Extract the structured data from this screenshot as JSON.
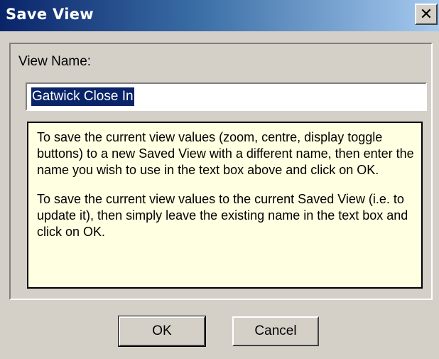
{
  "window": {
    "title": "Save View",
    "close_glyph": "✕",
    "close_icon": "close-icon"
  },
  "form": {
    "label": "View Name:",
    "input_value": "Gatwick Close In"
  },
  "info": {
    "paragraph1": "To save the current view values (zoom, centre, display toggle buttons) to a new Saved View with a different name, then enter the name you wish to use in the text box above and click on OK.",
    "paragraph2": "To save the current view values to the current Saved View (i.e. to update it), then simply leave the existing name in the text box and click on OK."
  },
  "buttons": {
    "ok": "OK",
    "cancel": "Cancel"
  },
  "colors": {
    "title_gradient_start": "#0a246a",
    "title_gradient_end": "#a6caf0",
    "dialog_face": "#d4d0c8",
    "tooltip_background": "#ffffe1",
    "selection": "#0a246a"
  }
}
